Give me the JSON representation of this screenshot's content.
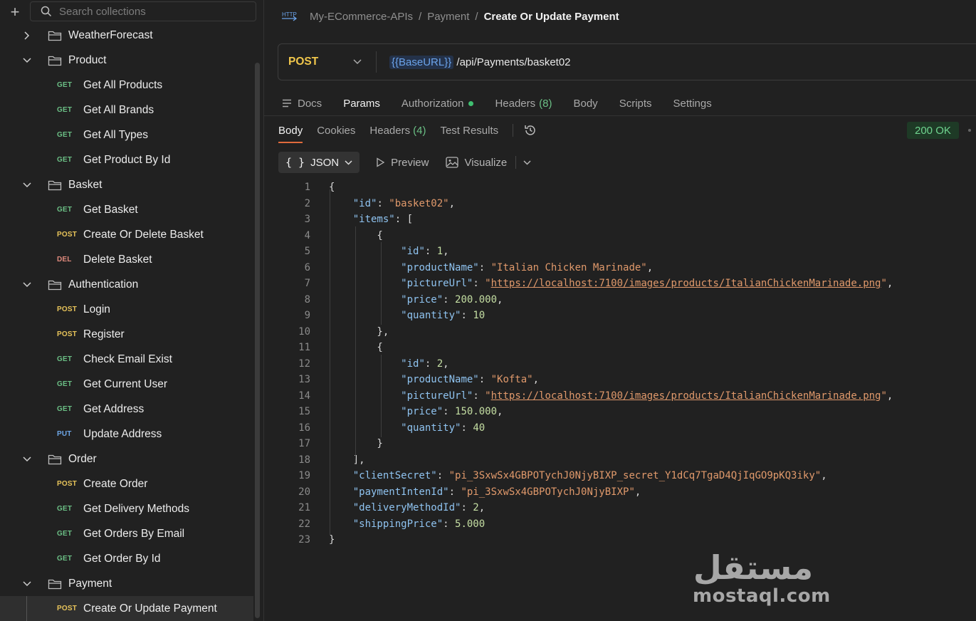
{
  "sidebar": {
    "search_placeholder": "Search collections",
    "tree": [
      {
        "type": "folder",
        "label": "WeatherForecast",
        "expanded": false
      },
      {
        "type": "folder",
        "label": "Product",
        "expanded": true
      },
      {
        "type": "request",
        "method": "GET",
        "label": "Get All Products"
      },
      {
        "type": "request",
        "method": "GET",
        "label": "Get All Brands"
      },
      {
        "type": "request",
        "method": "GET",
        "label": "Get All Types"
      },
      {
        "type": "request",
        "method": "GET",
        "label": "Get Product By Id"
      },
      {
        "type": "folder",
        "label": "Basket",
        "expanded": true
      },
      {
        "type": "request",
        "method": "GET",
        "label": "Get Basket"
      },
      {
        "type": "request",
        "method": "POST",
        "label": "Create Or Delete Basket"
      },
      {
        "type": "request",
        "method": "DEL",
        "label": "Delete Basket"
      },
      {
        "type": "folder",
        "label": "Authentication",
        "expanded": true
      },
      {
        "type": "request",
        "method": "POST",
        "label": "Login"
      },
      {
        "type": "request",
        "method": "POST",
        "label": "Register"
      },
      {
        "type": "request",
        "method": "GET",
        "label": "Check Email Exist"
      },
      {
        "type": "request",
        "method": "GET",
        "label": "Get Current User"
      },
      {
        "type": "request",
        "method": "GET",
        "label": "Get Address"
      },
      {
        "type": "request",
        "method": "PUT",
        "label": "Update Address"
      },
      {
        "type": "folder",
        "label": "Order",
        "expanded": true
      },
      {
        "type": "request",
        "method": "POST",
        "label": "Create Order"
      },
      {
        "type": "request",
        "method": "GET",
        "label": "Get Delivery Methods"
      },
      {
        "type": "request",
        "method": "GET",
        "label": "Get Orders By Email"
      },
      {
        "type": "request",
        "method": "GET",
        "label": "Get Order By Id"
      },
      {
        "type": "folder",
        "label": "Payment",
        "expanded": true
      },
      {
        "type": "request",
        "method": "POST",
        "label": "Create Or Update Payment",
        "active": true
      }
    ]
  },
  "breadcrumb": {
    "icon_text": "HTTP",
    "collection": "My-ECommerce-APIs",
    "folder": "Payment",
    "current": "Create Or Update Payment"
  },
  "request": {
    "method": "POST",
    "url_var": "{{BaseURL}}",
    "url_path": " /api/Payments/basket02"
  },
  "request_tabs": {
    "docs": "Docs",
    "params": "Params",
    "authorization": "Authorization",
    "headers": "Headers",
    "headers_count": "(8)",
    "body": "Body",
    "scripts": "Scripts",
    "settings": "Settings"
  },
  "response_tabs": {
    "body": "Body",
    "cookies": "Cookies",
    "headers": "Headers",
    "headers_count": "(4)",
    "test_results": "Test Results"
  },
  "status": "200 OK",
  "viewbar": {
    "format": "JSON",
    "preview": "Preview",
    "visualize": "Visualize"
  },
  "code_lines": [
    [
      [
        "p",
        "{"
      ]
    ],
    [
      [
        "p",
        "    "
      ],
      [
        "k",
        "\"id\""
      ],
      [
        "p",
        ": "
      ],
      [
        "s",
        "\"basket02\""
      ],
      [
        "p",
        ","
      ]
    ],
    [
      [
        "p",
        "    "
      ],
      [
        "k",
        "\"items\""
      ],
      [
        "p",
        ": ["
      ]
    ],
    [
      [
        "p",
        "        {"
      ]
    ],
    [
      [
        "p",
        "            "
      ],
      [
        "k",
        "\"id\""
      ],
      [
        "p",
        ": "
      ],
      [
        "n",
        "1"
      ],
      [
        "p",
        ","
      ]
    ],
    [
      [
        "p",
        "            "
      ],
      [
        "k",
        "\"productName\""
      ],
      [
        "p",
        ": "
      ],
      [
        "s",
        "\"Italian Chicken Marinade\""
      ],
      [
        "p",
        ","
      ]
    ],
    [
      [
        "p",
        "            "
      ],
      [
        "k",
        "\"pictureUrl\""
      ],
      [
        "p",
        ": "
      ],
      [
        "s",
        "\""
      ],
      [
        "u",
        "https://localhost:7100/images/products/ItalianChickenMarinade.png"
      ],
      [
        "s",
        "\""
      ],
      [
        "p",
        ","
      ]
    ],
    [
      [
        "p",
        "            "
      ],
      [
        "k",
        "\"price\""
      ],
      [
        "p",
        ": "
      ],
      [
        "n",
        "200.000"
      ],
      [
        "p",
        ","
      ]
    ],
    [
      [
        "p",
        "            "
      ],
      [
        "k",
        "\"quantity\""
      ],
      [
        "p",
        ": "
      ],
      [
        "n",
        "10"
      ]
    ],
    [
      [
        "p",
        "        },"
      ]
    ],
    [
      [
        "p",
        "        {"
      ]
    ],
    [
      [
        "p",
        "            "
      ],
      [
        "k",
        "\"id\""
      ],
      [
        "p",
        ": "
      ],
      [
        "n",
        "2"
      ],
      [
        "p",
        ","
      ]
    ],
    [
      [
        "p",
        "            "
      ],
      [
        "k",
        "\"productName\""
      ],
      [
        "p",
        ": "
      ],
      [
        "s",
        "\"Kofta\""
      ],
      [
        "p",
        ","
      ]
    ],
    [
      [
        "p",
        "            "
      ],
      [
        "k",
        "\"pictureUrl\""
      ],
      [
        "p",
        ": "
      ],
      [
        "s",
        "\""
      ],
      [
        "u",
        "https://localhost:7100/images/products/ItalianChickenMarinade.png"
      ],
      [
        "s",
        "\""
      ],
      [
        "p",
        ","
      ]
    ],
    [
      [
        "p",
        "            "
      ],
      [
        "k",
        "\"price\""
      ],
      [
        "p",
        ": "
      ],
      [
        "n",
        "150.000"
      ],
      [
        "p",
        ","
      ]
    ],
    [
      [
        "p",
        "            "
      ],
      [
        "k",
        "\"quantity\""
      ],
      [
        "p",
        ": "
      ],
      [
        "n",
        "40"
      ]
    ],
    [
      [
        "p",
        "        }"
      ]
    ],
    [
      [
        "p",
        "    ],"
      ]
    ],
    [
      [
        "p",
        "    "
      ],
      [
        "k",
        "\"clientSecret\""
      ],
      [
        "p",
        ": "
      ],
      [
        "s",
        "\"pi_3SxwSx4GBPOTychJ0NjyBIXP_secret_Y1dCq7TgaD4QjIqGO9pKQ3iky\""
      ],
      [
        "p",
        ","
      ]
    ],
    [
      [
        "p",
        "    "
      ],
      [
        "k",
        "\"paymentIntenId\""
      ],
      [
        "p",
        ": "
      ],
      [
        "s",
        "\"pi_3SxwSx4GBPOTychJ0NjyBIXP\""
      ],
      [
        "p",
        ","
      ]
    ],
    [
      [
        "p",
        "    "
      ],
      [
        "k",
        "\"deliveryMethodId\""
      ],
      [
        "p",
        ": "
      ],
      [
        "n",
        "2"
      ],
      [
        "p",
        ","
      ]
    ],
    [
      [
        "p",
        "    "
      ],
      [
        "k",
        "\"shippingPrice\""
      ],
      [
        "p",
        ": "
      ],
      [
        "n",
        "5.000"
      ]
    ],
    [
      [
        "p",
        "}"
      ]
    ]
  ],
  "watermark": {
    "arabic": "مستقل",
    "latin": "mostaql.com"
  },
  "colors": {
    "GET": "#6bbf85",
    "POST": "#e8c45a",
    "DEL": "#e08a7d",
    "PUT": "#6ea7e8"
  }
}
